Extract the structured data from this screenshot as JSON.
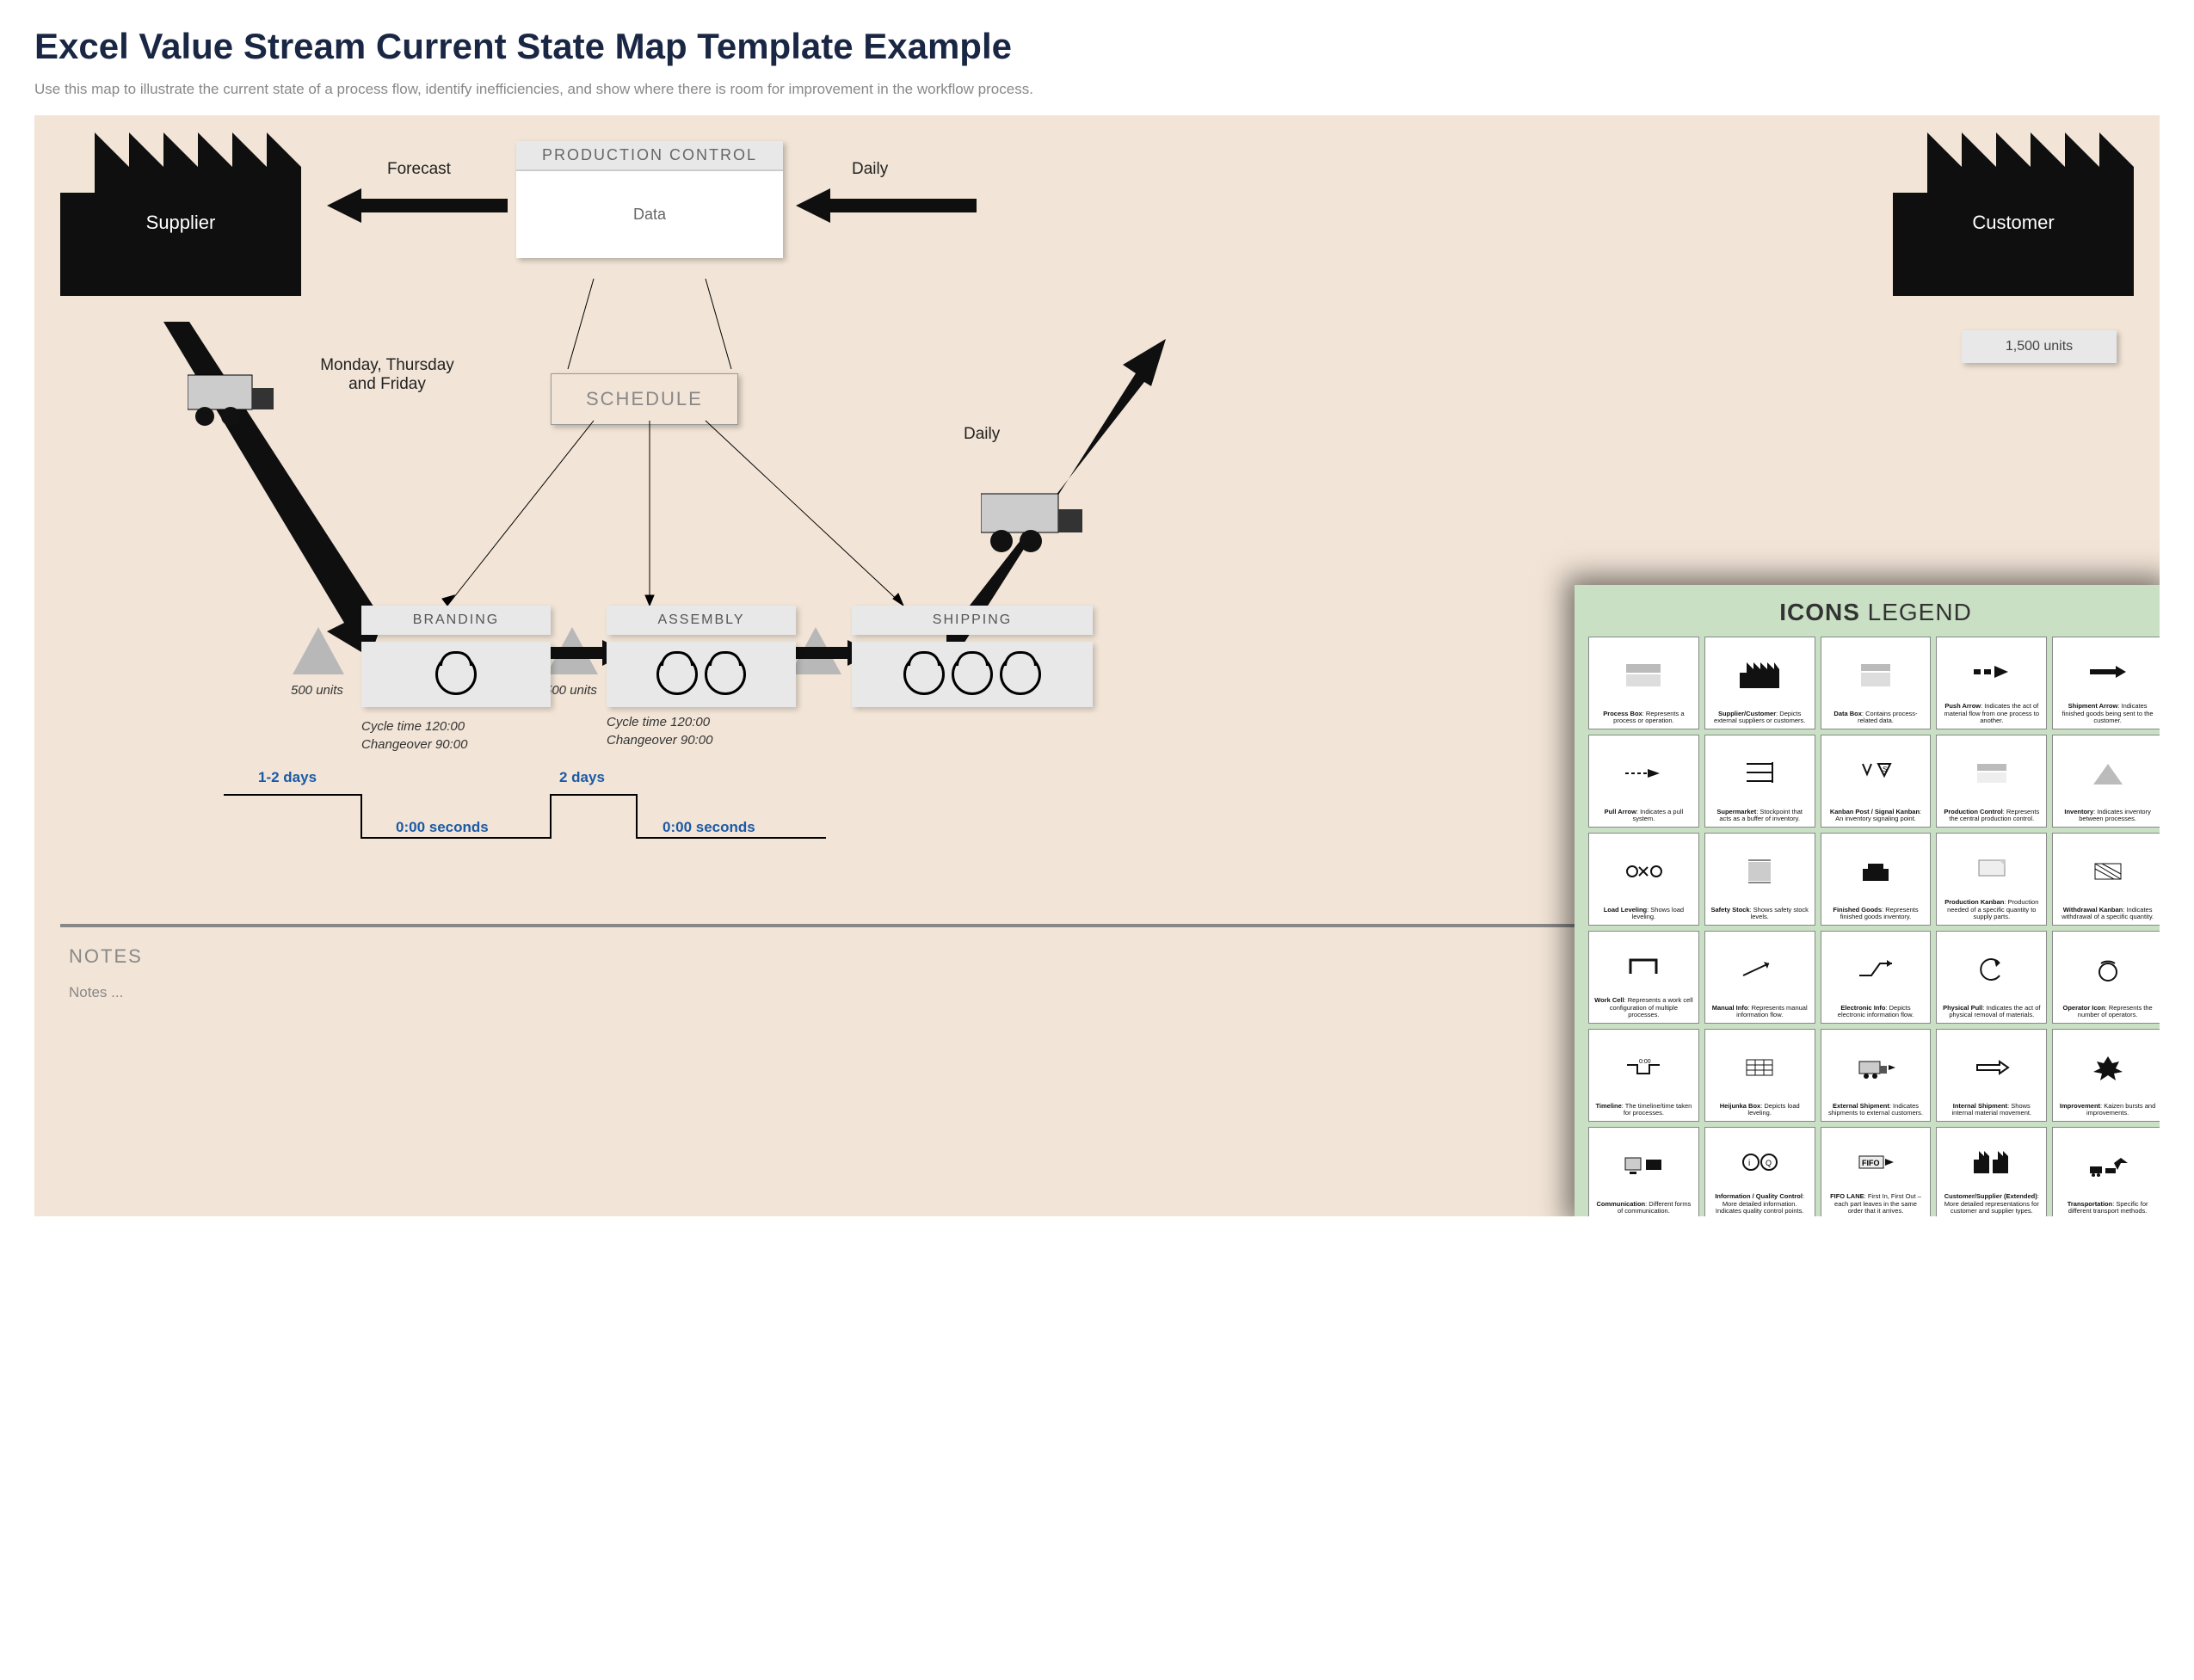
{
  "title": "Excel Value Stream Current State Map Template Example",
  "subtitle": "Use this map to illustrate the current state of a process flow, identify inefficiencies, and show where there is room for improvement in the workflow process.",
  "supplier_label": "Supplier",
  "customer_label": "Customer",
  "production_control": {
    "header": "PRODUCTION CONTROL",
    "body": "Data"
  },
  "forecast_label": "Forecast",
  "daily_label_top": "Daily",
  "schedule_label": "SCHEDULE",
  "supplier_shipment_note": "Monday, Thursday and Friday",
  "customer_units": "1,500 units",
  "customer_ship_freq": "Daily",
  "inventory1": "500 units",
  "inventory2": "500 units",
  "processes": [
    {
      "name": "BRANDING",
      "operators": 1,
      "cycle": "Cycle time 120:00",
      "change": "Changeover 90:00"
    },
    {
      "name": "ASSEMBLY",
      "operators": 2,
      "cycle": "Cycle time 120:00",
      "change": "Changeover 90:00"
    },
    {
      "name": "SHIPPING",
      "operators": 3,
      "cycle": "",
      "change": ""
    }
  ],
  "timeline": {
    "top1": "1-2 days",
    "bot1": "0:00 seconds",
    "top2": "2 days",
    "bot2": "0:00 seconds"
  },
  "notes_header": "NOTES",
  "notes_body": "Notes ...",
  "legend_title_bold": "ICONS",
  "legend_title_rest": " LEGEND",
  "legend": [
    {
      "name": "Process Box",
      "desc": "Represents a process or operation."
    },
    {
      "name": "Supplier/Customer",
      "desc": "Depicts external suppliers or customers."
    },
    {
      "name": "Data Box",
      "desc": "Contains process-related data."
    },
    {
      "name": "Push Arrow",
      "desc": "Indicates the act of material flow from one process to another."
    },
    {
      "name": "Shipment Arrow",
      "desc": "Indicates finished goods being sent to the customer."
    },
    {
      "name": "Pull Arrow",
      "desc": "Indicates a pull system."
    },
    {
      "name": "Supermarket",
      "desc": "Stockpoint that acts as a buffer of inventory."
    },
    {
      "name": "Kanban Post / Signal Kanban",
      "desc": "An inventory signaling point."
    },
    {
      "name": "Production Control",
      "desc": "Represents the central production control."
    },
    {
      "name": "Inventory",
      "desc": "Indicates inventory between processes."
    },
    {
      "name": "Load Leveling",
      "desc": "Shows load leveling."
    },
    {
      "name": "Safety Stock",
      "desc": "Shows safety stock levels."
    },
    {
      "name": "Finished Goods",
      "desc": "Represents finished goods inventory."
    },
    {
      "name": "Production Kanban",
      "desc": "Production needed of a specific quantity to supply parts."
    },
    {
      "name": "Withdrawal Kanban",
      "desc": "Indicates withdrawal of a specific quantity."
    },
    {
      "name": "Work Cell",
      "desc": "Represents a work cell configuration of multiple processes."
    },
    {
      "name": "Manual Info",
      "desc": "Represents manual information flow."
    },
    {
      "name": "Electronic Info",
      "desc": "Depicts electronic information flow."
    },
    {
      "name": "Physical Pull",
      "desc": "Indicates the act of physical removal of materials."
    },
    {
      "name": "Operator Icon",
      "desc": "Represents the number of operators."
    },
    {
      "name": "Timeline",
      "desc": "The timeline/time taken for processes."
    },
    {
      "name": "Heijunka Box",
      "desc": "Depicts load leveling."
    },
    {
      "name": "External Shipment",
      "desc": "Indicates shipments to external customers."
    },
    {
      "name": "Internal Shipment",
      "desc": "Shows internal material movement."
    },
    {
      "name": "Improvement",
      "desc": "Kaizen bursts and improvements."
    },
    {
      "name": "Communication",
      "desc": "Different forms of communication."
    },
    {
      "name": "Information / Quality Control",
      "desc": "More detailed information. Indicates quality control points."
    },
    {
      "name": "FIFO LANE",
      "desc": "First In, First Out – each part leaves in the same order that it arrives."
    },
    {
      "name": "Customer/Supplier (Extended)",
      "desc": "More detailed representations for customer and supplier types."
    },
    {
      "name": "Transportation",
      "desc": "Specific for different transport methods."
    }
  ]
}
